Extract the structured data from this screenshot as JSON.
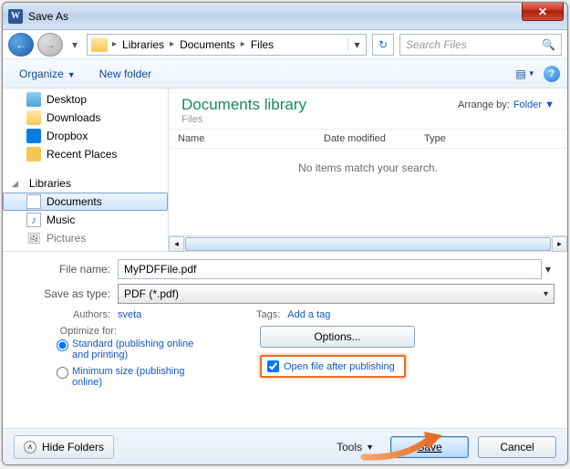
{
  "title": "Save As",
  "close_x": "✕",
  "nav": {
    "back": "←",
    "forward": "→",
    "recent": "▾"
  },
  "breadcrumb": {
    "items": [
      "Libraries",
      "Documents",
      "Files"
    ]
  },
  "refresh": "↻",
  "search": {
    "placeholder": "Search Files",
    "icon": "🔍"
  },
  "toolbar": {
    "organize": "Organize",
    "newfolder": "New folder"
  },
  "help_q": "?",
  "sidebar": {
    "items0": {
      "label": "Desktop"
    },
    "items1": {
      "label": "Downloads"
    },
    "items2": {
      "label": "Dropbox"
    },
    "items3": {
      "label": "Recent Places"
    },
    "header": {
      "label": "Libraries"
    },
    "items4": {
      "label": "Documents"
    },
    "items5": {
      "label": "Music"
    },
    "items6": {
      "label": "Pictures"
    }
  },
  "pane": {
    "title": "Documents library",
    "subtitle": "Files",
    "arrange_by": "Arrange by:",
    "arrange_val": "Folder",
    "col_name": "Name",
    "col_date": "Date modified",
    "col_type": "Type",
    "empty": "No items match your search."
  },
  "fields": {
    "filename_label": "File name:",
    "filename_value": "MyPDFFile.pdf",
    "savetype_label": "Save as type:",
    "savetype_value": "PDF (*.pdf)",
    "authors_label": "Authors:",
    "authors_value": "sveta",
    "tags_label": "Tags:",
    "tags_value": "Add a tag",
    "optimize_label": "Optimize for:",
    "opt_standard": "Standard (publishing online and printing)",
    "opt_minimum": "Minimum size (publishing online)",
    "options_btn": "Options...",
    "open_after": "Open file after publishing"
  },
  "footer": {
    "hide": "Hide Folders",
    "tools": "Tools",
    "save": "Save",
    "cancel": "Cancel"
  }
}
